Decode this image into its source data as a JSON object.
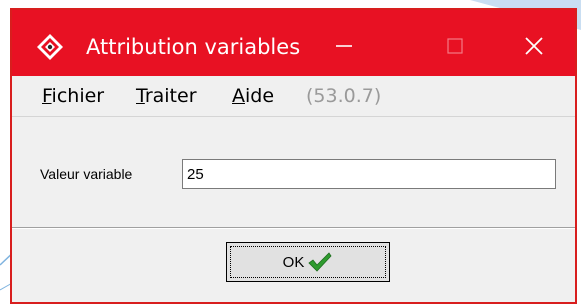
{
  "window": {
    "title": "Attribution variables",
    "icon": "app-diamond-icon",
    "title_bar_color": "#e81123",
    "border_color": "#d81e1e"
  },
  "title_controls": {
    "minimize_icon": "minimize-icon",
    "maximize_icon": "maximize-icon",
    "close_icon": "close-icon"
  },
  "menu": {
    "items": [
      {
        "label_first": "F",
        "label_rest": "ichier"
      },
      {
        "label_first": "T",
        "label_rest": "raiter"
      },
      {
        "label_first": "A",
        "label_rest": "ide"
      }
    ],
    "version": "(53.0.7)"
  },
  "form": {
    "label": "Valeur variable",
    "value": "25"
  },
  "ok_button": {
    "label": "OK",
    "icon": "green-check-icon",
    "icon_color": "#2e9b2e"
  }
}
